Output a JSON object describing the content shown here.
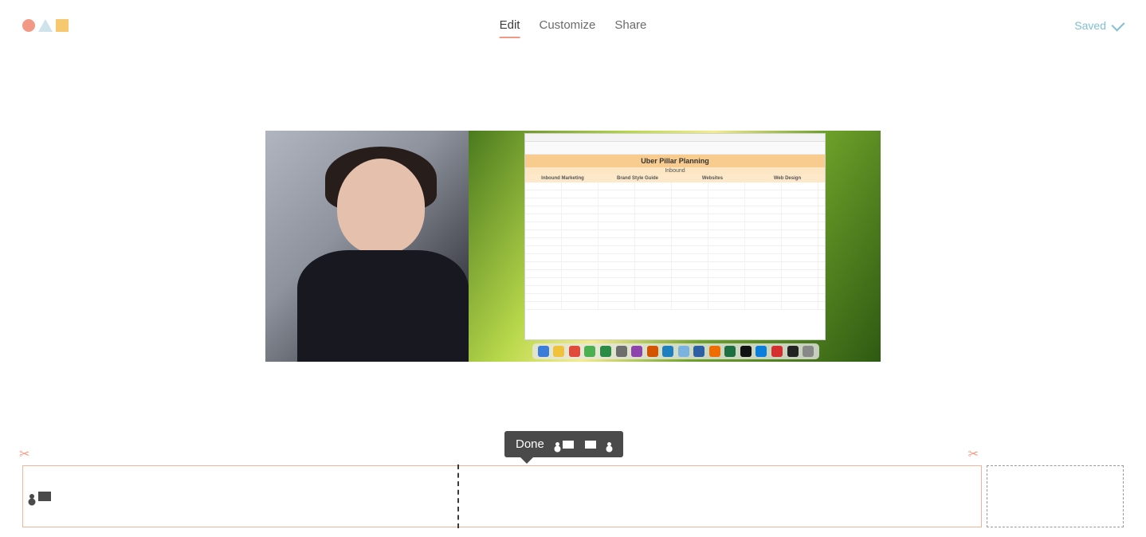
{
  "nav": {
    "edit": "Edit",
    "customize": "Customize",
    "share": "Share"
  },
  "status": {
    "saved": "Saved"
  },
  "spreadsheet": {
    "title": "Uber Pillar Planning",
    "sub": "Inbound",
    "columns": {
      "c1": "Inbound Marketing",
      "c2": "Brand Style Guide",
      "c3": "Websites",
      "c4": "Web Design"
    }
  },
  "toolbar": {
    "done": "Done"
  },
  "icons": {
    "scissors": "✂",
    "logo": "logo"
  }
}
